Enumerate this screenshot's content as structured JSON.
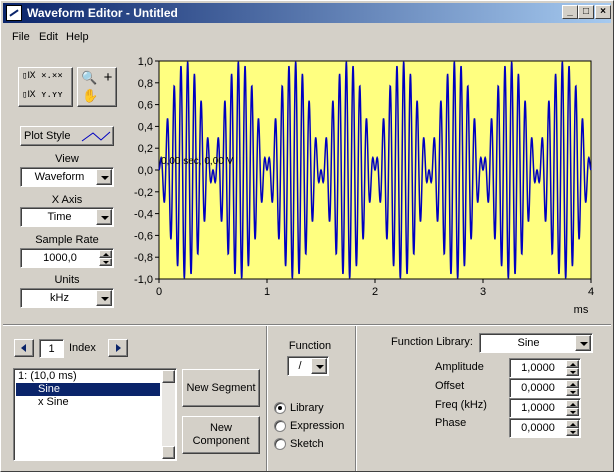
{
  "window": {
    "title": "Waveform Editor - Untitled",
    "minimize": "_",
    "maximize": "□",
    "close": "×"
  },
  "menu": [
    "File",
    "Edit",
    "Help"
  ],
  "left": {
    "plot_style_label": "Plot Style",
    "view_label": "View",
    "view_value": "Waveform",
    "xaxis_label": "X Axis",
    "xaxis_value": "Time",
    "sample_rate_label": "Sample Rate",
    "sample_rate_value": "1000,0",
    "units_label": "Units",
    "units_value": "kHz"
  },
  "graph": {
    "annotation": "0,00 sec, 0,00 V"
  },
  "bottom": {
    "index_value": "1",
    "index_label": "Index",
    "list": [
      "1:  (10,0 ms)",
      "Sine",
      "x Sine"
    ],
    "new_segment": "New Segment",
    "new_component": "New Component",
    "function_label": "Function",
    "function_value": "/",
    "radios": [
      "Library",
      "Expression",
      "Sketch"
    ],
    "func_library_label": "Function Library:",
    "func_library_value": "Sine",
    "params": [
      {
        "label": "Amplitude",
        "value": "1,0000"
      },
      {
        "label": "Offset",
        "value": "0,0000"
      },
      {
        "label": "Freq (kHz)",
        "value": "1,0000"
      },
      {
        "label": "Phase",
        "value": "0,0000"
      }
    ]
  },
  "chart_data": {
    "type": "line",
    "title": "",
    "xlabel": "ms",
    "ylabel": "",
    "xlim": [
      0,
      4
    ],
    "ylim": [
      -1,
      1
    ],
    "xticks": [
      "0",
      "1",
      "2",
      "3",
      "4"
    ],
    "yticks": [
      "1,0",
      "0,8",
      "0,6",
      "0,4",
      "0,2",
      "0,0",
      "-0,2",
      "-0,4",
      "-0,6",
      "-0,8",
      "-1,0"
    ],
    "background": "#ffff80",
    "line_color": "#0000c0",
    "series": [
      {
        "formula": "sin(2π·1·t)·sin(2π·16·t)",
        "carrier_khz": 16,
        "envelope_khz": 1,
        "x_start": 0,
        "x_end": 4
      }
    ]
  }
}
